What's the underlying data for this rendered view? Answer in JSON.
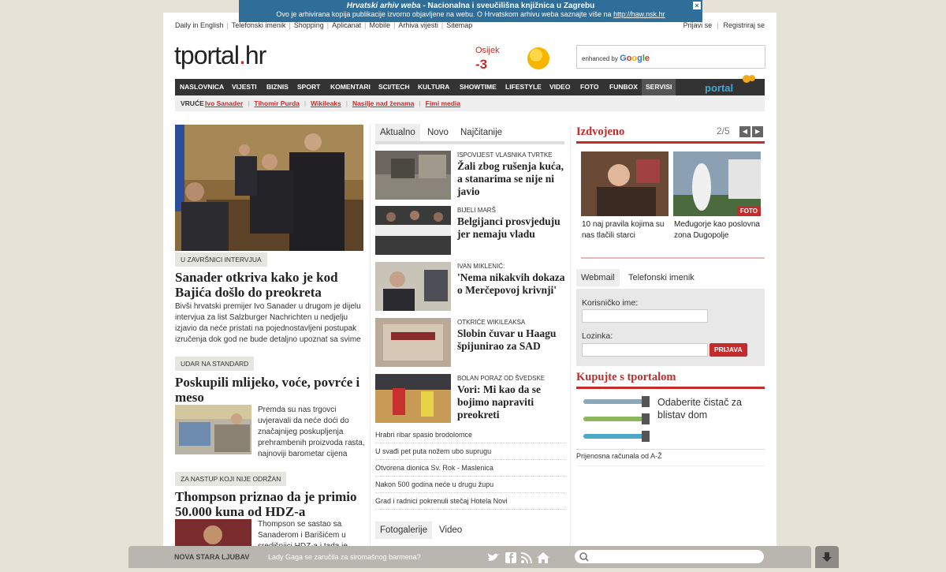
{
  "banner": {
    "title_italic": "Hrvatski arhiv weba",
    "title_rest": " - Nacionalna i sveučilišna knjižnica u Zagrebu",
    "line2": "Ovo je arhivirana kopija publikacije izvorno objavljene na webu. O Hrvatskom arhivu weba saznajte više na",
    "link": "http://haw.nsk.hr",
    "close": "×"
  },
  "topbar": {
    "links": [
      "Daily in English",
      "Telefonski imenik",
      "Shopping",
      "Aplicanat",
      "Mobile",
      "Arhiva vijesti",
      "Sitemap"
    ],
    "login": "Prijavi se",
    "register": "Registriraj se"
  },
  "logo": {
    "text": "tportal",
    "dot": ".",
    "tld": "hr"
  },
  "weather": {
    "city": "Osijek",
    "temp": "-3",
    "icon": "sun-icon"
  },
  "search": {
    "enhanced_by": "enhanced by",
    "google": "Google"
  },
  "nav": {
    "items": [
      "NASLOVNICA",
      "VIJESTI",
      "BIZNIS",
      "SPORT",
      "KOMENTARI",
      "SCI/TECH",
      "KULTURA",
      "SHOWTIME",
      "LIFESTYLE",
      "VIDEO",
      "FOTO",
      "FUNBOX",
      "SERVISI"
    ],
    "active_index": 12,
    "portal_logo": "portal"
  },
  "hot": {
    "label": "VRUĆE",
    "tags": [
      "Ivo Sanader",
      "Tihomir Purda",
      "Wikileaks",
      "Nasilje nad ženama",
      "Fimi media"
    ]
  },
  "left": {
    "lead": {
      "kicker": "U ZAVRŠNICI INTERVJUA",
      "headline": "Sanader otkriva kako je kod Bajića došlo do preokreta",
      "body": "Bivši hrvatski premijer Ivo Sanader u drugom je dijelu intervjua za list Salzburger Nachrichten u nedjelju izjavio da neće pristati na pojednostavljeni postupak izručenja dok god ne bude detaljno upoznat sa svime čime ga se"
    },
    "story2": {
      "kicker": "UDAR NA STANDARD",
      "headline": "Poskupili mlijeko, voće, povrće i meso",
      "body": "Premda su nas trgovci uvjeravali da neće doći do značajnijeg poskupljenja prehrambenih proizvoda rasta, najnoviji barometar cijena"
    },
    "story3": {
      "kicker": "ZA NASTUP KOJI NIJE ODRŽAN",
      "headline": "Thompson priznao da je primio 50.000 kuna od HDZ-a",
      "body": "Thompson se sastao sa Sanaderom i Barišićem u središnjici HDZ-a i tada je"
    }
  },
  "middle": {
    "tabs": [
      "Aktualno",
      "Novo",
      "Najčitanije"
    ],
    "items": [
      {
        "kicker": "ISPOVIJEST VLASNIKA TVRTKE",
        "headline": "Žali zbog rušenja kuća, a stanarima se nije ni javio"
      },
      {
        "kicker": "BIJELI MARŠ",
        "headline": "Belgijanci prosvjeduju jer nemaju vladu"
      },
      {
        "kicker": "IVAN MIKLENIĆ:",
        "headline": "'Nema nikakvih dokaza o Merčepovoj krivnji'"
      },
      {
        "kicker": "OTKRIĆE WIKILEAKSA",
        "headline": "Slobin čuvar u Haagu špijunirao za SAD"
      },
      {
        "kicker": "BOLAN PORAZ OD ŠVEDSKE",
        "headline": "Vori: Mi kao da se bojimo napraviti preokreti"
      }
    ],
    "plain": [
      "Hrabri ribar spasio brodolomce",
      "U svađi pet puta nožem ubo suprugu",
      "Otvorena dionica Sv. Rok - Maslenica",
      "Nakon 500 godina neće u drugu župu",
      "Grad i radnici pokrenuli stečaj Hotela Novi"
    ],
    "tabs2": [
      "Fotogalerije",
      "Video"
    ]
  },
  "right": {
    "izdvojeno": {
      "title": "Izdvojeno",
      "pager": "2/5",
      "prev": "◀",
      "next": "▶",
      "items": [
        {
          "caption": "10 naj pravila kojima su nas tlačili starci"
        },
        {
          "caption": "Međugorje kao poslovna zona Dugopolje",
          "badge": "FOTO"
        }
      ]
    },
    "webmail": {
      "tabs": [
        "Webmail",
        "Telefonski imenik"
      ],
      "user_label": "Korisničko ime:",
      "pass_label": "Lozinka:",
      "button": "PRIJAVA"
    },
    "shop": {
      "title": "Kupujte s tportalom",
      "product": "Odaberite čistač za blistav dom",
      "link": "Prijenosna računala od A-Ž"
    }
  },
  "bottombar": {
    "label": "NOVA STARA LJUBAV",
    "text": "Lady Gaga se zaručila za siromašnog barmena?",
    "icons": [
      "twitter-icon",
      "facebook-icon",
      "rss-icon",
      "home-icon"
    ],
    "search_icon": "search-icon",
    "down": "down-arrow-icon"
  },
  "colors": {
    "accent": "#c62b2b",
    "nav_bg": "#333333",
    "banner_bg": "#2e6e98"
  }
}
